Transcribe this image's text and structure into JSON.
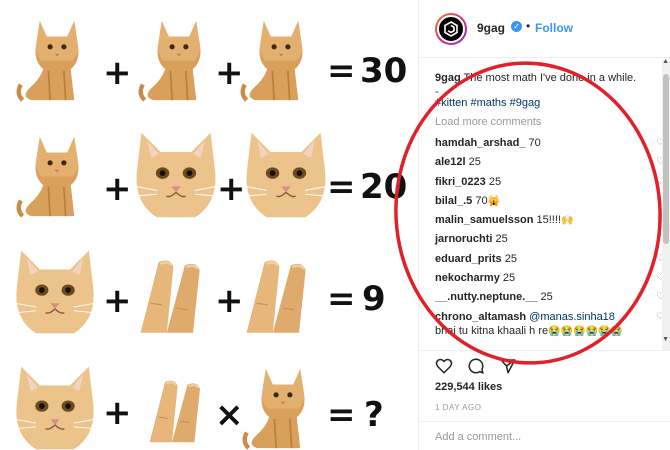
{
  "puzzle": {
    "rows": [
      {
        "op1": "+",
        "op2": "+",
        "equals": "=",
        "result": "30"
      },
      {
        "op1": "+",
        "op2": "+",
        "equals": "=",
        "result": "20"
      },
      {
        "op1": "+",
        "op2": "+",
        "equals": "=",
        "result": "9"
      },
      {
        "op1": "+",
        "op2": "×",
        "equals": "=",
        "result": "?"
      }
    ]
  },
  "header": {
    "username": "9gag",
    "verified_mark": "✓",
    "separator": "•",
    "follow_label": "Follow"
  },
  "caption": {
    "user": "9gag",
    "text": " The most math I've done in a while.",
    "dash": "-",
    "hashtags": "#kitten #maths #9gag"
  },
  "load_more": "Load more comments",
  "comments": [
    {
      "user": "hamdah_arshad_",
      "text": " 70"
    },
    {
      "user": "ale12l",
      "text": " 25"
    },
    {
      "user": "fikri_0223",
      "text": " 25"
    },
    {
      "user": "bilal_.5",
      "text": " 70",
      "emoji": "🙀"
    },
    {
      "user": "malin_samuelsson",
      "text": " 15!!!!",
      "emoji": "🙌"
    },
    {
      "user": "jarnoruchti",
      "text": " 25"
    },
    {
      "user": "eduard_prits",
      "text": " 25"
    },
    {
      "user": "nekocharmy",
      "text": " 25"
    },
    {
      "user": "__.nutty.neptune.__",
      "text": " 25"
    },
    {
      "user": "chrono_altamash",
      "mention": " @manas.sinha18",
      "text2": "bhai tu kitna khaali h re",
      "emoji": "😭😭😭😭😭😭"
    }
  ],
  "icons": {
    "heart": "heart-outline-icon",
    "like": "heart-icon",
    "comment": "comment-icon",
    "share": "share-icon"
  },
  "likes": "229,544 likes",
  "time": "1 DAY AGO",
  "add_comment_placeholder": "Add a comment...",
  "colors": {
    "link": "#3897f0",
    "hashtag": "#003569",
    "annotation": "#e0202a"
  }
}
